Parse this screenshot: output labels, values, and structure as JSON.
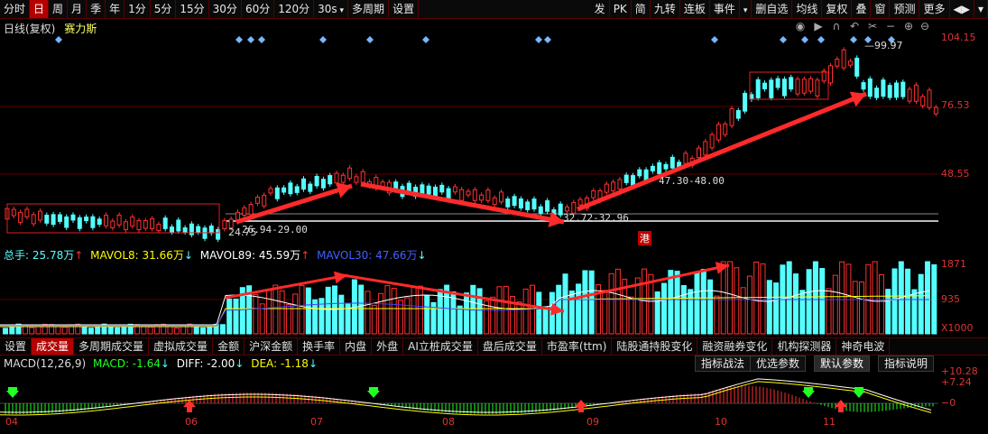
{
  "toolbar": {
    "left": [
      "分时",
      "日",
      "周",
      "月",
      "季",
      "年",
      "1分",
      "5分",
      "15分",
      "30分",
      "60分",
      "120分",
      "30s",
      "多周期",
      "设置"
    ],
    "right": [
      "发",
      "PK",
      "简",
      "九转",
      "连板",
      "事件",
      "",
      "删自选",
      "均线",
      "复权",
      "叠",
      "窗",
      "预测",
      "更多"
    ]
  },
  "kline": {
    "title": "日线(复权)",
    "stock": "赛力斯",
    "price_max": "104.15",
    "price_mid": "76.53",
    "price_low": "48.55",
    "high_label": "99.97",
    "low_label": "24.75",
    "range1": "26.94-29.00",
    "range2": "32.72-32.96",
    "range3": "47.30-48.00",
    "hk_tag": "港"
  },
  "volume": {
    "total_label": "总手: 25.78万",
    "ma8": "MAVOL8: 31.66万",
    "ma89": "MAVOL89: 45.59万",
    "ma30": "MAVOL30: 47.66万",
    "y_top": "1871",
    "y_mid": "935",
    "y_unit": "X1000",
    "colors": {
      "up": "#ff3030",
      "down": "#54ffff",
      "ma8": "#ffffff",
      "ma30": "#4040ff",
      "ma89": "#ffff00"
    }
  },
  "tabs": [
    "设置",
    "成交量",
    "多周期成交量",
    "虚拟成交量",
    "金额",
    "沪深金额",
    "换手率",
    "内盘",
    "外盘",
    "AI立桩成交量",
    "盘后成交量",
    "市盈率(ttm)",
    "陆股通持股变化",
    "融资融券变化",
    "机构探测器",
    "神奇电波"
  ],
  "macd": {
    "name": "MACD(12,26,9)",
    "macd": "MACD: -1.64",
    "diff": "DIFF: -2.00",
    "dea": "DEA: -1.18",
    "y_top": "10.28",
    "y_mid": "7.24",
    "y_zero": "0",
    "buttons": [
      "指标战法",
      "优选参数",
      "默认参数",
      "指标说明"
    ]
  },
  "months": [
    "04",
    "06",
    "07",
    "08",
    "09",
    "10",
    "11"
  ]
}
